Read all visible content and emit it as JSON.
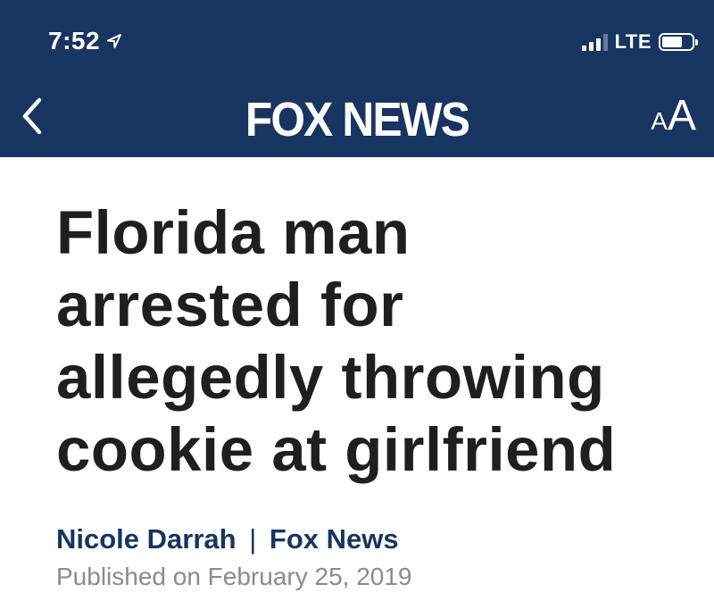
{
  "status_bar": {
    "time": "7:52",
    "network": "LTE"
  },
  "nav": {
    "logo": "FOX NEWS",
    "text_size_small": "A",
    "text_size_large": "A"
  },
  "article": {
    "headline": "Florida man arrested for allegedly throwing cookie at girlfriend",
    "author": "Nicole Darrah",
    "separator": "|",
    "source": "Fox News",
    "published": "Published on February 25, 2019"
  },
  "colors": {
    "header_bg": "#183561",
    "byline": "#183561",
    "headline": "#1f1f1f",
    "published": "#8b8b8b"
  }
}
